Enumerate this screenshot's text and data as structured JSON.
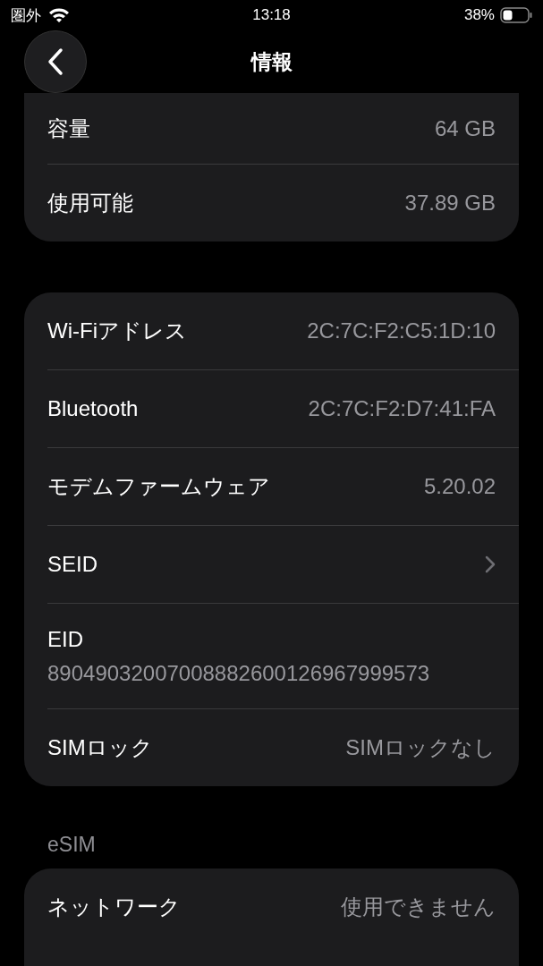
{
  "status_bar": {
    "carrier": "圏外",
    "time": "13:18",
    "battery": "38%"
  },
  "navigation": {
    "title": "情報"
  },
  "sections": [
    {
      "rows": [
        {
          "kind": "value",
          "label": "容量",
          "value": "64 GB"
        },
        {
          "kind": "value",
          "label": "使用可能",
          "value": "37.89 GB"
        }
      ]
    },
    {
      "rows": [
        {
          "kind": "value",
          "label": "Wi-Fiアドレス",
          "value": "2C:7C:F2:C5:1D:10"
        },
        {
          "kind": "value",
          "label": "Bluetooth",
          "value": "2C:7C:F2:D7:41:FA"
        },
        {
          "kind": "value",
          "label": "モデムファームウェア",
          "value": "5.20.02"
        },
        {
          "kind": "link",
          "label": "SEID"
        },
        {
          "kind": "stacked",
          "label": "EID",
          "value": "89049032007008882600126967999573"
        },
        {
          "kind": "value",
          "label": "SIMロック",
          "value": "SIMロックなし"
        }
      ]
    },
    {
      "header": "eSIM",
      "rows": [
        {
          "kind": "value",
          "label": "ネットワーク",
          "value": "使用できません"
        }
      ]
    }
  ]
}
